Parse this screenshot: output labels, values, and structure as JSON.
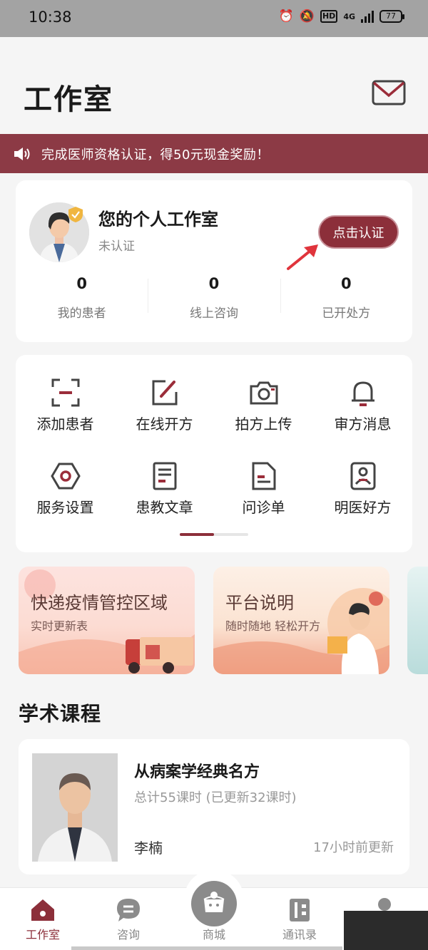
{
  "status_bar": {
    "time": "10:38",
    "signal": "4G",
    "battery": "77"
  },
  "header": {
    "title": "工作室",
    "mail_icon": "mail-icon"
  },
  "notice": {
    "text": "完成医师资格认证，得50元现金奖励！"
  },
  "profile": {
    "name": "您的个人工作室",
    "status": "未认证",
    "certify_label": "点击认证",
    "stats": [
      {
        "value": "0",
        "label": "我的患者"
      },
      {
        "value": "0",
        "label": "线上咨询"
      },
      {
        "value": "0",
        "label": "已开处方"
      }
    ]
  },
  "shortcuts": [
    {
      "label": "添加患者",
      "icon": "scan-icon"
    },
    {
      "label": "在线开方",
      "icon": "edit-icon"
    },
    {
      "label": "拍方上传",
      "icon": "camera-icon"
    },
    {
      "label": "审方消息",
      "icon": "bell-icon"
    },
    {
      "label": "服务设置",
      "icon": "settings-icon"
    },
    {
      "label": "患教文章",
      "icon": "article-icon"
    },
    {
      "label": "问诊单",
      "icon": "form-icon"
    },
    {
      "label": "明医好方",
      "icon": "id-card-icon"
    }
  ],
  "banners": [
    {
      "title": "快递疫情管控区域",
      "subtitle": "实时更新表"
    },
    {
      "title": "平台说明",
      "subtitle": "随时随地 轻松开方"
    }
  ],
  "courses_section": {
    "title": "学术课程",
    "course": {
      "title": "从病案学经典名方",
      "meta": "总计55课时 (已更新32课时)",
      "teacher": "李楠",
      "updated": "17小时前更新"
    }
  },
  "tabbar": [
    {
      "label": "工作室",
      "icon": "home-icon",
      "active": true
    },
    {
      "label": "咨询",
      "icon": "chat-icon",
      "active": false
    },
    {
      "label": "商城",
      "icon": "shop-icon",
      "active": false
    },
    {
      "label": "通讯录",
      "icon": "contacts-icon",
      "active": false
    }
  ],
  "colors": {
    "accent": "#8c2f3a",
    "notice_bg": "#8c3a45"
  }
}
